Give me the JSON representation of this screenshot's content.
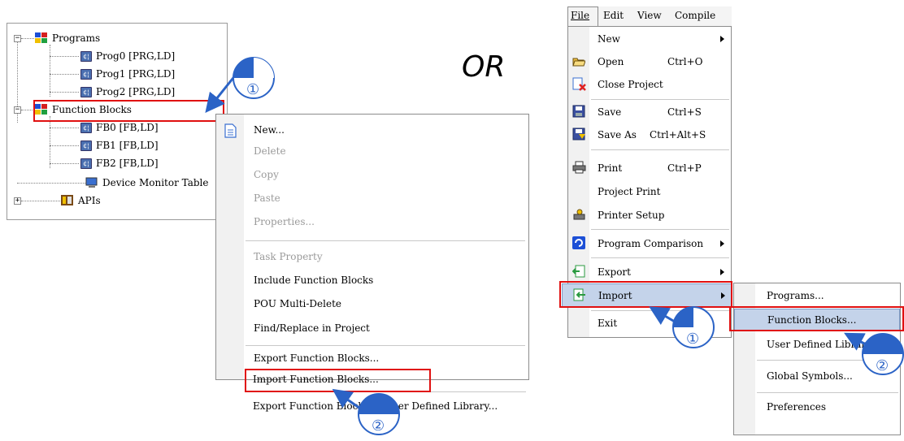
{
  "tree": {
    "programs": "Programs",
    "prog0": "Prog0 [PRG,LD]",
    "prog1": "Prog1 [PRG,LD]",
    "prog2": "Prog2 [PRG,LD]",
    "function_blocks": "Function Blocks",
    "fb0": "FB0 [FB,LD]",
    "fb1": "FB1 [FB,LD]",
    "fb2": "FB2 [FB,LD]",
    "device_monitor": "Device Monitor Table",
    "apis": "APIs"
  },
  "or_text": "OR",
  "step_markers": {
    "one": "①",
    "two": "②"
  },
  "context_menu": {
    "new": "New...",
    "delete": "Delete",
    "copy": "Copy",
    "paste": "Paste",
    "properties": "Properties...",
    "task_property": "Task Property",
    "include_fb": "Include Function Blocks",
    "pou_multi_delete": "POU Multi-Delete",
    "find_replace": "Find/Replace in Project",
    "export_fb": "Export Function Blocks...",
    "import_fb": "Import Function Blocks...",
    "export_fb_udl": "Export Function Blocks to User Defined Library..."
  },
  "menubar": {
    "file": "File",
    "edit": "Edit",
    "view": "View",
    "compile": "Compile"
  },
  "file_menu": {
    "new": "New",
    "open": "Open",
    "open_sc": "Ctrl+O",
    "close_project": "Close Project",
    "save": "Save",
    "save_sc": "Ctrl+S",
    "save_as": "Save As",
    "save_as_sc": "Ctrl+Alt+S",
    "print": "Print",
    "print_sc": "Ctrl+P",
    "project_print": "Project Print",
    "printer_setup": "Printer Setup",
    "program_comparison": "Program Comparison",
    "export": "Export",
    "import": "Import",
    "exit": "Exit"
  },
  "import_submenu": {
    "programs": "Programs...",
    "function_blocks": "Function Blocks...",
    "user_defined_library": "User Defined Library...",
    "global_symbols": "Global Symbols...",
    "preferences": "Preferences"
  },
  "colors": {
    "highlight_red": "#e01010",
    "menu_highlight": "#c4d3ea",
    "callout_blue": "#2b63c6"
  }
}
